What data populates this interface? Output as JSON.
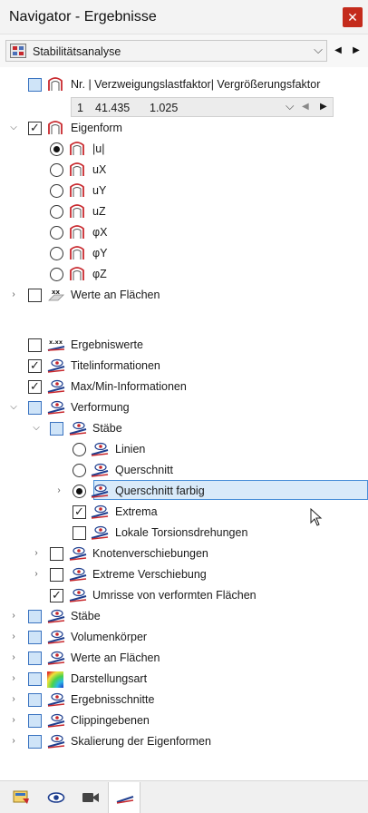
{
  "window": {
    "title": "Navigator - Ergebnisse",
    "close_label": "✕"
  },
  "analysis": {
    "selected": "Stabilitätsanalyse",
    "prev_label": "◀",
    "next_label": "▶"
  },
  "mode_row": {
    "label": "Nr. | Verzweigungslastfaktor| Vergrößerungsfaktor",
    "nr": "1",
    "factor": "41.435",
    "magnification": "1.025",
    "chev": "⌵",
    "prev": "◀",
    "next": "▶"
  },
  "tree": {
    "eigenform": {
      "label": "Eigenform"
    },
    "modes": [
      {
        "label": "|u|",
        "checked": true
      },
      {
        "label": "uX",
        "checked": false
      },
      {
        "label": "uY",
        "checked": false
      },
      {
        "label": "uZ",
        "checked": false
      },
      {
        "label": "φX",
        "checked": false
      },
      {
        "label": "φY",
        "checked": false
      },
      {
        "label": "φZ",
        "checked": false
      }
    ],
    "werte_flaechen_top": {
      "label": "Werte an Flächen"
    },
    "ergebniswerte": {
      "label": "Ergebniswerte"
    },
    "titelinfo": {
      "label": "Titelinformationen"
    },
    "maxmin": {
      "label": "Max/Min-Informationen"
    },
    "verformung": {
      "label": "Verformung"
    },
    "staebe_sub": {
      "label": "Stäbe"
    },
    "linien": {
      "label": "Linien"
    },
    "querschnitt": {
      "label": "Querschnitt"
    },
    "querschnitt_farbig": {
      "label": "Querschnitt farbig"
    },
    "extrema": {
      "label": "Extrema"
    },
    "lokale_torsion": {
      "label": "Lokale Torsionsdrehungen"
    },
    "knoten": {
      "label": "Knotenverschiebungen"
    },
    "extreme_versch": {
      "label": "Extreme Verschiebung"
    },
    "umrisse": {
      "label": "Umrisse von verformten Flächen"
    },
    "staebe": {
      "label": "Stäbe"
    },
    "volumen": {
      "label": "Volumenkörper"
    },
    "werte_flaechen": {
      "label": "Werte an Flächen"
    },
    "darstellung": {
      "label": "Darstellungsart"
    },
    "ergebnisschnitte": {
      "label": "Ergebnisschnitte"
    },
    "clipping": {
      "label": "Clippingebenen"
    },
    "skalierung": {
      "label": "Skalierung der Eigenformen"
    }
  },
  "glyphs": {
    "expanded": "⌵",
    "collapsed": "›"
  },
  "icons": {
    "mode": "mode-shape-icon",
    "eye": "result-eye-icon",
    "values": "values-xx-icon",
    "color": "color-gradient-icon"
  },
  "colors": {
    "accent": "#4a8fd8",
    "selection": "#d9eaf9",
    "close": "#c42b1c",
    "partial": "#cfe4f8",
    "eye_red": "#c8282d",
    "eye_blue": "#1f3f8f"
  }
}
